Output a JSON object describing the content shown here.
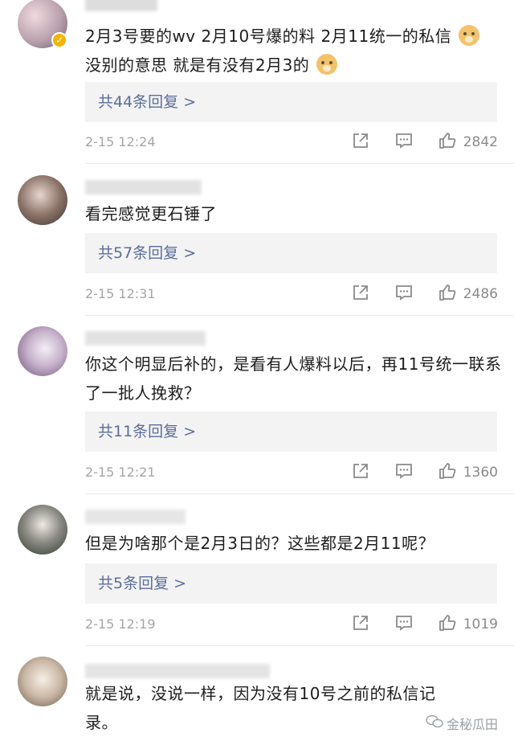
{
  "comments": [
    {
      "text_a": "2月3号要的wv 2月10号爆的料 2月11统一的私信",
      "text_b": "没别的意思 就是有没有2月3的",
      "replies": "共44条回复",
      "time": "2-15 12:24",
      "likes": "2842",
      "verified": true
    },
    {
      "text": "看完感觉更石锤了",
      "replies": "共57条回复",
      "time": "2-15 12:31",
      "likes": "2486"
    },
    {
      "text": "你这个明显后补的，是看有人爆料以后，再11号统一联系了一批人挽救？",
      "replies": "共11条回复",
      "time": "2-15 12:21",
      "likes": "1360"
    },
    {
      "text": "但是为啥那个是2月3日的？这些都是2月11呢？",
      "replies": "共5条回复",
      "time": "2-15 12:19",
      "likes": "1019"
    },
    {
      "text": "就是说，没说一样，因为没有10号之前的私信记录。"
    }
  ],
  "reply_chevron": ">",
  "watermark": "金秘瓜田",
  "icons": {
    "share": "share-icon",
    "comment": "comment-icon",
    "like": "thumbs-up-icon",
    "dog": "dog-emoji-icon"
  },
  "colors": {
    "reply_link": "#5a6d9b",
    "reply_bg": "#f3f3f3",
    "meta": "#a5a5a5",
    "verified": "#f4b400"
  }
}
